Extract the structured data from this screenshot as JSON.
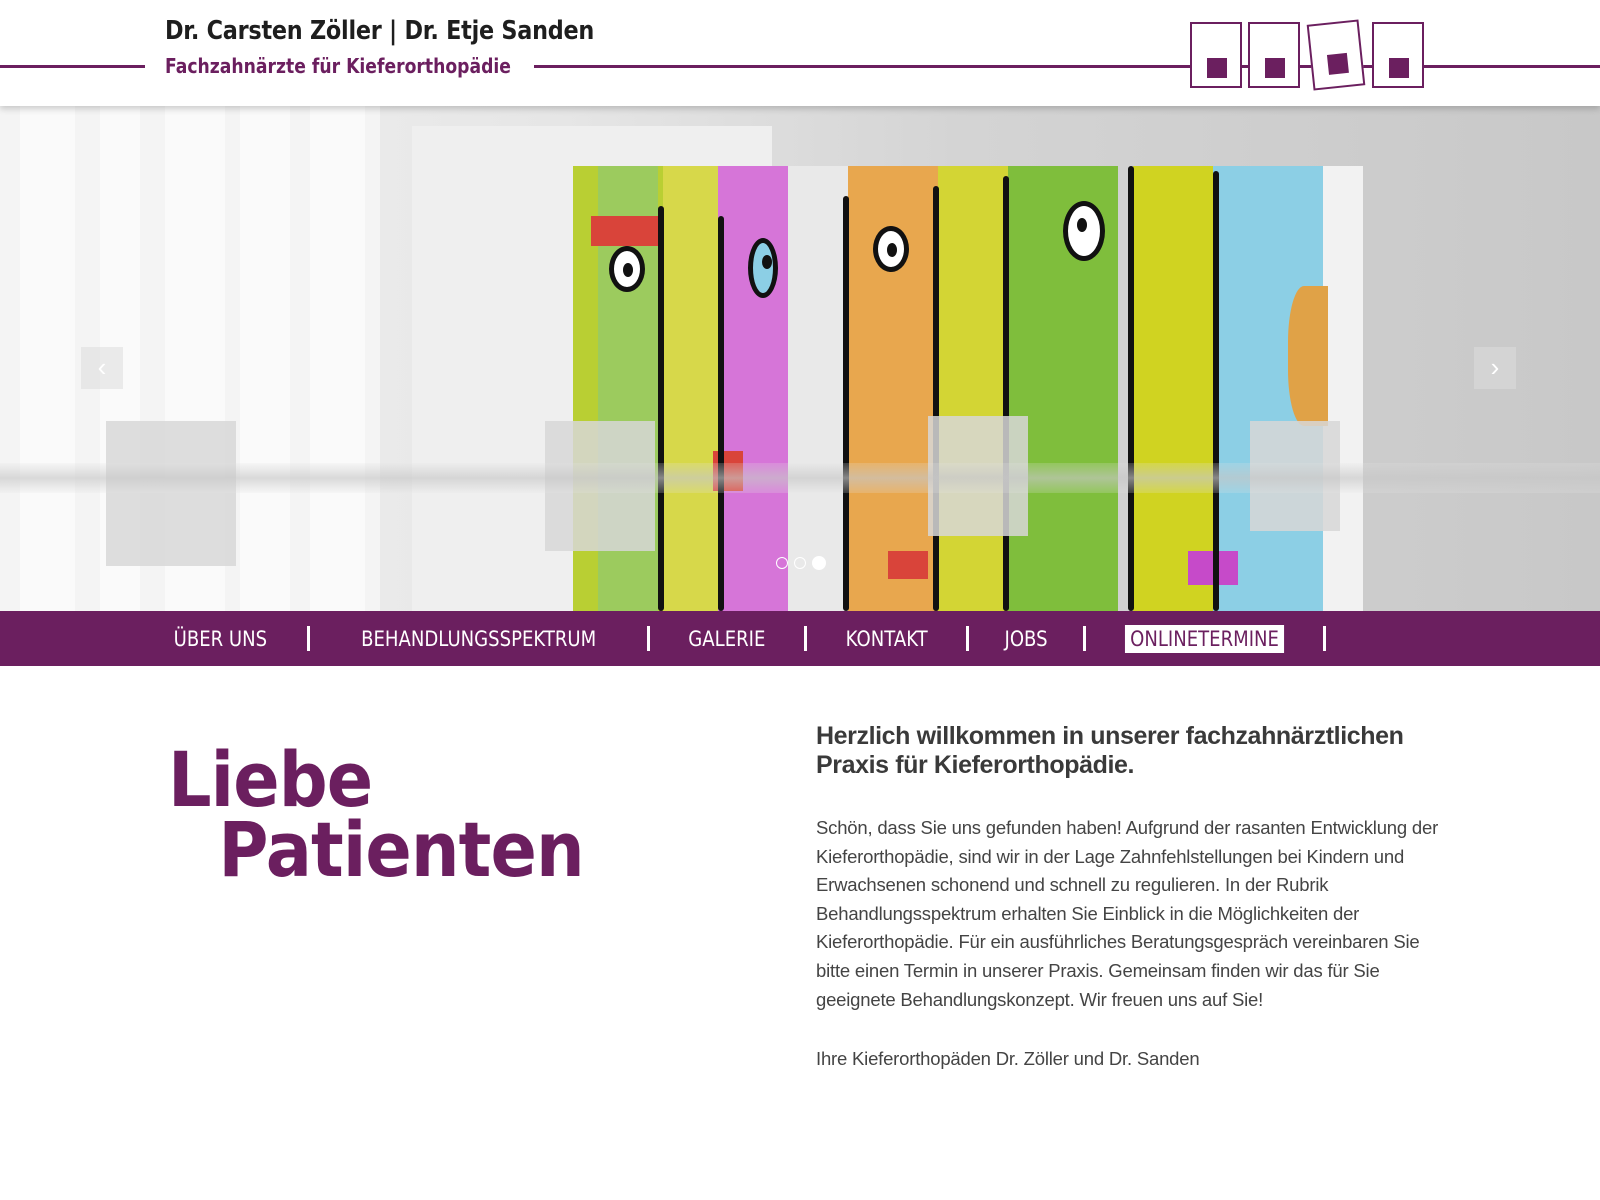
{
  "header": {
    "doctor_names": "Dr. Carsten Zöller |  Dr. Etje Sanden",
    "subtitle": "Fachzahnärzte für Kieferorthopädie",
    "brand_color": "#6b1f5f"
  },
  "hero": {
    "prev_arrow": "‹",
    "next_arrow": "›",
    "slide_count": 3,
    "active_slide": 3
  },
  "nav": {
    "items": [
      {
        "label": "ÜBER UNS"
      },
      {
        "label": "BEHANDLUNGSSPEKTRUM"
      },
      {
        "label": "GALERIE"
      },
      {
        "label": "KONTAKT"
      },
      {
        "label": "JOBS"
      },
      {
        "label": "ONLINETERMINE",
        "active": true
      }
    ]
  },
  "content": {
    "headline_line1": "Liebe",
    "headline_line2": "Patienten",
    "welcome": "Herzlich willkommen in unserer fachzahnärztlichen Praxis für Kieferorthopädie.",
    "intro": "Schön, dass Sie uns gefunden haben! Aufgrund der rasanten Entwicklung der Kieferorthopädie, sind wir in der Lage Zahnfehlstellungen bei Kindern und Erwachsenen schonend und schnell zu regulieren. In der Rubrik Behandlungsspektrum erhalten Sie Einblick in die Möglichkeiten der Kieferorthopädie. Für ein ausführliches Beratungsgespräch vereinbaren Sie bitte einen Termin in unserer Praxis. Gemeinsam finden wir das für Sie geeignete Behandlungskonzept. Wir freuen uns auf Sie!",
    "signature": "Ihre Kieferorthopäden Dr. Zöller und Dr. Sanden"
  }
}
